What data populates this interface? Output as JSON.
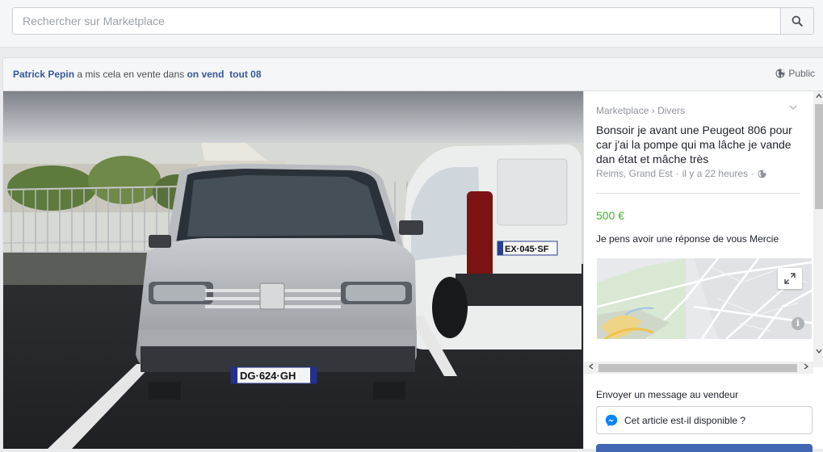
{
  "search": {
    "placeholder": "Rechercher sur Marketplace",
    "value": ""
  },
  "post": {
    "author": "Patrick Pepin",
    "action_text": "a mis cela en vente dans",
    "group_prefix": "on vend",
    "group_name": "tout 08",
    "audience": "Public"
  },
  "listing": {
    "breadcrumb_marketplace": "Marketplace",
    "breadcrumb_separator": "›",
    "breadcrumb_category": "Divers",
    "title": "Bonsoir je avant une Peugeot 806 pour car j'ai la pompe qui ma lâche je vande dan état et mâche très",
    "location": "Reims, Grand Est",
    "time": "il y a 22 heures",
    "meta_separator": "·",
    "price": "500 €",
    "comment": "Je pens avoir une réponse de vous Mercie",
    "map_info_glyph": "i"
  },
  "message": {
    "label": "Envoyer un message au vendeur",
    "prefill": "Cet article est-il disponible ?"
  },
  "photo": {
    "front_plate": "DG·624·GH",
    "van_plate": "EX·045·SF"
  },
  "colors": {
    "link": "#365899",
    "price": "#42b72a",
    "messenger": "#0084ff",
    "send_button": "#4267b2"
  },
  "icons": {
    "search": "search-icon",
    "globe": "globe-icon",
    "expand": "expand-icon",
    "messenger": "messenger-icon",
    "info": "info-icon"
  }
}
